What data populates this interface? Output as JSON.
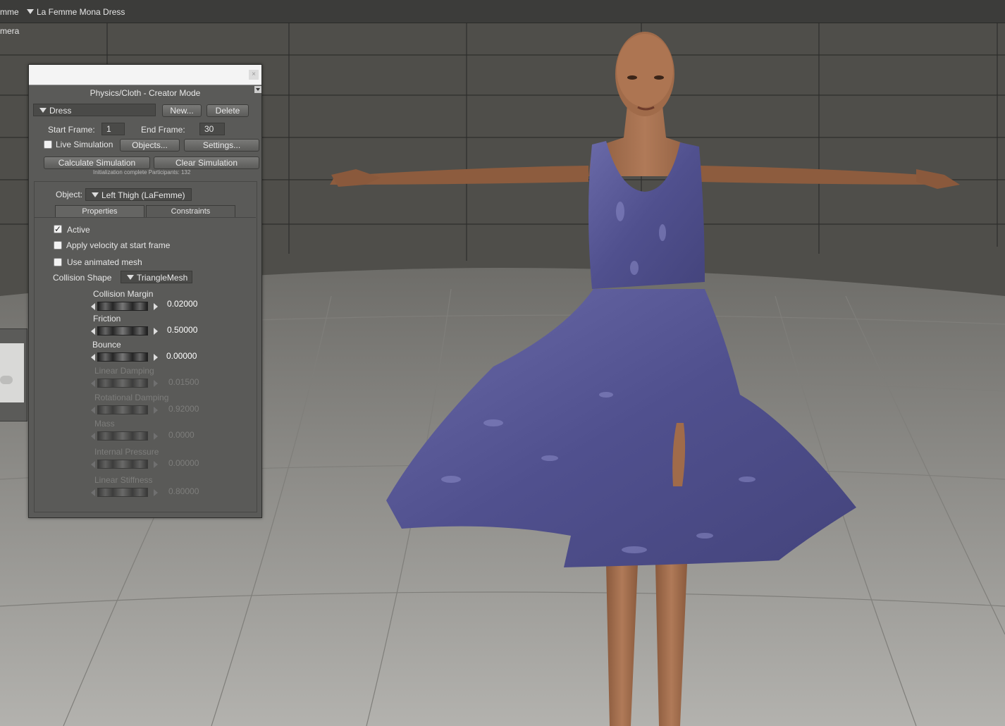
{
  "top_bar": {
    "left_fragment": "mme",
    "figure_menu": "La Femme Mona Dress",
    "camera_label": "mera"
  },
  "panel": {
    "title": "Physics/Cloth - Creator Mode",
    "close_label": "×",
    "simulation_select": "Dress",
    "new_button": "New...",
    "delete_button": "Delete",
    "start_frame_label": "Start Frame:",
    "start_frame_value": "1",
    "end_frame_label": "End Frame:",
    "end_frame_value": "30",
    "live_simulation_label": "Live Simulation",
    "live_simulation_checked": false,
    "objects_button": "Objects...",
    "settings_button": "Settings...",
    "calculate_button": "Calculate Simulation",
    "clear_button": "Clear Simulation",
    "status_text": "Initialization complete  Participants: 132",
    "object_label": "Object:",
    "object_select": "Left Thigh (LaFemme)",
    "tabs": {
      "properties": "Properties",
      "constraints": "Constraints"
    },
    "active_tab": "Properties",
    "properties": {
      "active_label": "Active",
      "active_checked": true,
      "apply_velocity_label": "Apply velocity at start frame",
      "apply_velocity_checked": false,
      "use_animated_mesh_label": "Use animated mesh",
      "use_animated_mesh_checked": false,
      "collision_shape_label": "Collision Shape",
      "collision_shape_value": "TriangleMesh",
      "sliders": [
        {
          "label": "Collision Margin",
          "value": "0.02000",
          "enabled": true
        },
        {
          "label": "Friction",
          "value": "0.50000",
          "enabled": true
        },
        {
          "label": "Bounce",
          "value": "0.00000",
          "enabled": true
        },
        {
          "label": "Linear Damping",
          "value": "0.01500",
          "enabled": false
        },
        {
          "label": "Rotational Damping",
          "value": "0.92000",
          "enabled": false
        },
        {
          "label": "Mass",
          "value": "0.0000",
          "enabled": false
        },
        {
          "label": "Internal Pressure",
          "value": "0.00000",
          "enabled": false
        },
        {
          "label": "Linear Stiffness",
          "value": "0.80000",
          "enabled": false
        }
      ]
    }
  },
  "colors": {
    "panel_bg": "#5a5a58",
    "dress": "#5a5a96",
    "skin": "#a06b4a",
    "floor": "#9a9995"
  }
}
